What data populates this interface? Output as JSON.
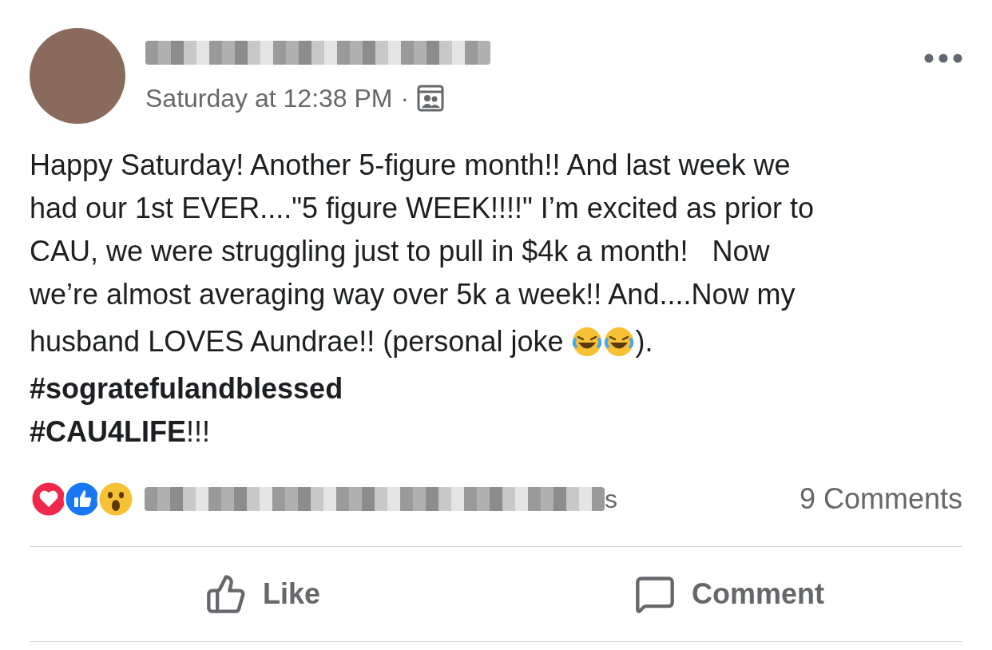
{
  "post": {
    "time": "Saturday at 12:38 PM",
    "separator": "·",
    "body_lines": [
      "Happy Saturday! Another 5-figure month!! And last week we",
      "had our 1st EVER....\"5 figure WEEK!!!!\" I’m excited as prior to",
      "CAU, we were struggling just to pull in $4k a month!   Now",
      "we’re almost averaging way over 5k a week!! And....Now my"
    ],
    "last_line": {
      "before": "husband LOVES Aundrae!! (personal joke",
      "after": ")."
    },
    "hashtags": [
      "**#sogratefulandblessed**",
      "**#CAU4LIFE**!!!"
    ],
    "reactions": {
      "names_tail": "s",
      "comments": "9 Comments"
    },
    "actions": [
      {
        "kind": "like",
        "label": "Like"
      },
      {
        "kind": "comment",
        "label": "Comment"
      }
    ]
  }
}
